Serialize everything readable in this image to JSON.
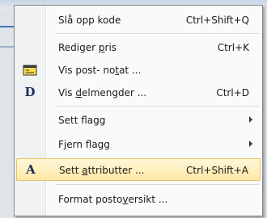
{
  "menu": {
    "items": [
      {
        "pre": "Slå opp kode",
        "acc": "",
        "post": "",
        "shortcut": "Ctrl+Shift+Q"
      },
      {
        "pre": "Rediger ",
        "acc": "p",
        "post": "ris",
        "shortcut": "Ctrl+K"
      },
      {
        "pre": "Vis post- no",
        "acc": "t",
        "post": "at ...",
        "shortcut": ""
      },
      {
        "pre": "Vis ",
        "acc": "d",
        "post": "elmengder ...",
        "shortcut": "Ctrl+D"
      },
      {
        "pre": "Sett flagg",
        "acc": "",
        "post": "",
        "shortcut": ""
      },
      {
        "pre": "Fjern flagg",
        "acc": "",
        "post": "",
        "shortcut": ""
      },
      {
        "pre": "Sett ",
        "acc": "a",
        "post": "ttributter ...",
        "shortcut": "Ctrl+Shift+A"
      },
      {
        "pre": "Format posto",
        "acc": "v",
        "post": "ersikt ...",
        "shortcut": ""
      }
    ],
    "glyphs": {
      "subsets": "D",
      "attributes": "A"
    },
    "colors": {
      "highlight": "#ffe8a6",
      "highlight_border": "#e5c365",
      "glyph": "#1e2a5a"
    }
  }
}
